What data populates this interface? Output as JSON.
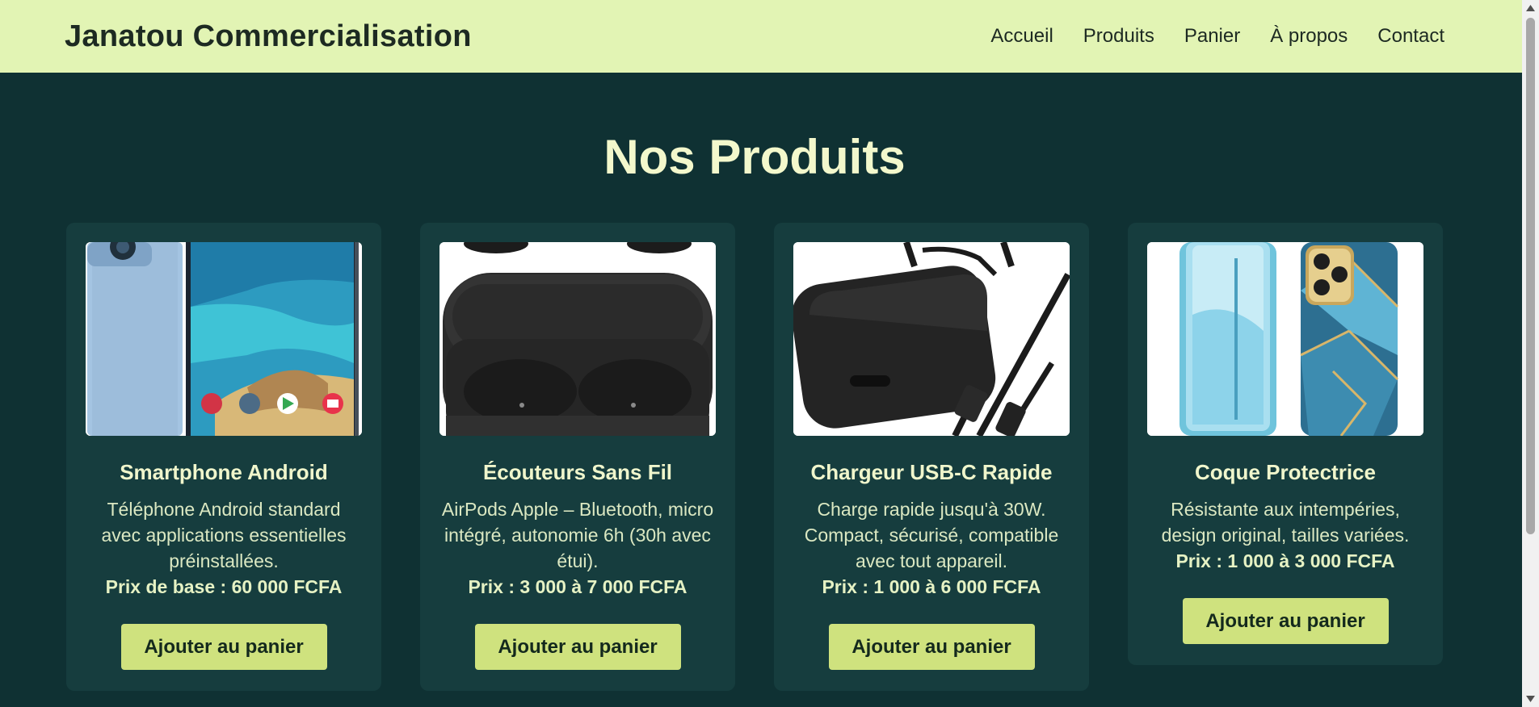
{
  "header": {
    "brand": "Janatou Commercialisation",
    "nav": [
      "Accueil",
      "Produits",
      "Panier",
      "À propos",
      "Contact"
    ]
  },
  "main": {
    "title": "Nos Produits"
  },
  "products": [
    {
      "name": "Smartphone Android",
      "description": "Téléphone Android standard avec applications essentielles préinstallées.",
      "price": "Prix de base : 60 000 FCFA",
      "button": "Ajouter au panier",
      "image_icon": "smartphone-image"
    },
    {
      "name": "Écouteurs Sans Fil",
      "description": "AirPods Apple – Bluetooth, micro intégré, autonomie 6h (30h avec étui).",
      "price": "Prix : 3 000 à 7 000 FCFA",
      "button": "Ajouter au panier",
      "image_icon": "earbuds-case-image"
    },
    {
      "name": "Chargeur USB-C Rapide",
      "description": "Charge rapide jusqu'à 30W. Compact, sécurisé, compatible avec tout appareil.",
      "price": "Prix : 1 000 à 6 000 FCFA",
      "button": "Ajouter au panier",
      "image_icon": "usb-c-charger-image"
    },
    {
      "name": "Coque Protectrice",
      "description": "Résistante aux intempéries, design original, tailles variées.",
      "price": "Prix : 1 000 à 3 000 FCFA",
      "button": "Ajouter au panier",
      "image_icon": "phone-case-image"
    }
  ],
  "colors": {
    "header_bg": "#e2f4b4",
    "page_bg": "#0f3133",
    "card_bg": "#163d3e",
    "button_bg": "#cfe27e",
    "title_text": "#f3f8cc"
  }
}
